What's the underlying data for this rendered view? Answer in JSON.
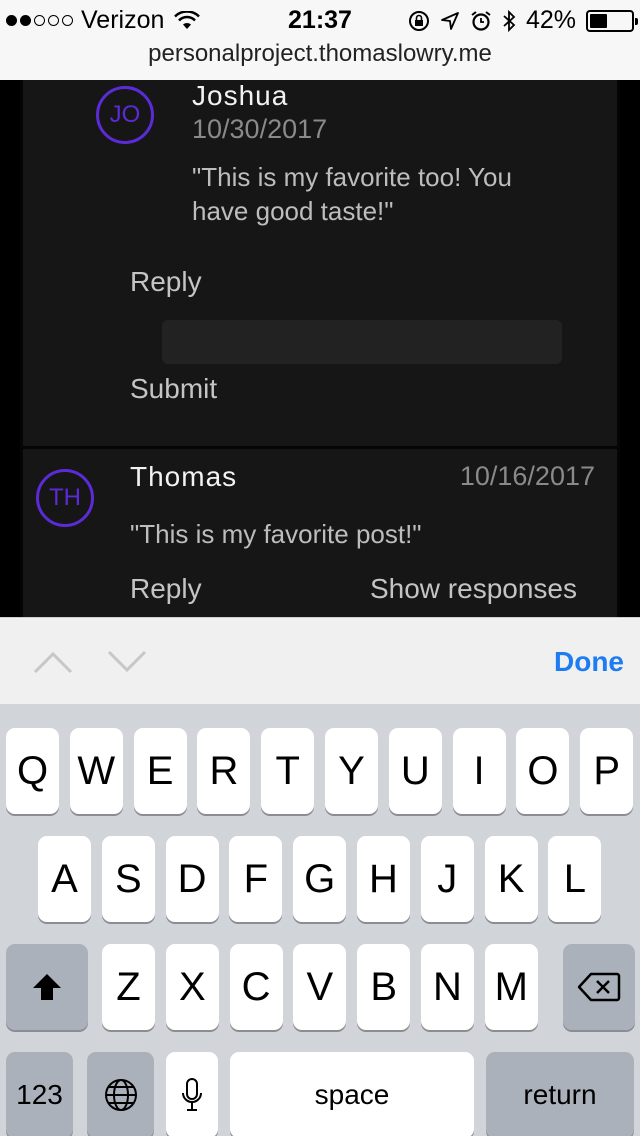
{
  "status_bar": {
    "carrier": "Verizon",
    "time": "21:37",
    "battery": "42%",
    "battery_level": 0.42,
    "url": "personalproject.thomaslowry.me"
  },
  "comments": {
    "reply": {
      "avatar": "JO",
      "name": "Joshua",
      "date": "10/30/2017",
      "text_line1": "\"This is my favorite too! You",
      "text_line2": "have good taste!\"",
      "reply_label": "Reply",
      "submit_label": "Submit"
    },
    "main": {
      "avatar": "TH",
      "name": "Thomas",
      "date": "10/16/2017",
      "text": "\"This is my favorite post!\"",
      "reply_label": "Reply",
      "show_responses_label": "Show responses"
    }
  },
  "accessory": {
    "done_label": "Done",
    "up_icon": "chevron-up-icon",
    "down_icon": "chevron-down-icon"
  },
  "keyboard": {
    "row1": [
      "Q",
      "W",
      "E",
      "R",
      "T",
      "Y",
      "U",
      "I",
      "O",
      "P"
    ],
    "row2": [
      "A",
      "S",
      "D",
      "F",
      "G",
      "H",
      "J",
      "K",
      "L"
    ],
    "row3": [
      "Z",
      "X",
      "C",
      "V",
      "B",
      "N",
      "M"
    ],
    "numbers_label": "123",
    "space_label": "space",
    "return_label": "return",
    "shift_icon": "shift-icon",
    "delete_icon": "backspace-icon",
    "globe_icon": "globe-icon",
    "mic_icon": "microphone-icon"
  }
}
